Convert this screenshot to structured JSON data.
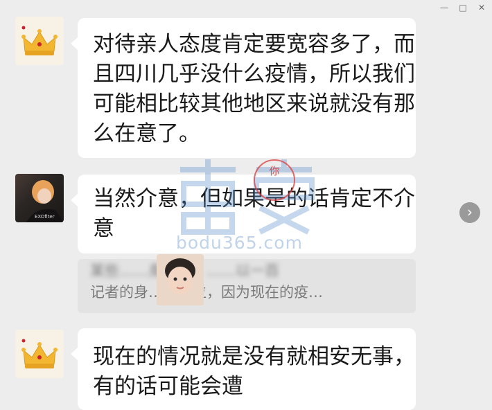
{
  "window": {
    "minimize_icon": "minimize-icon",
    "maximize_icon": "maximize-icon",
    "close_icon": "close-icon"
  },
  "messages": [
    {
      "avatar_icon": "crown-icon",
      "lines": [
        "对待亲人态度肯定要宽容多了，而",
        "且四川几乎没什么疫情，所以我们",
        "可能相比较其他地区来说就没有那",
        "么在意了。"
      ]
    },
    {
      "avatar_icon": "user-photo",
      "avatar_caption": "EXOfiter",
      "lines": [
        "当然介意，但如果是的话肯定不介",
        "意"
      ]
    },
    {
      "avatar_icon": "crown-icon",
      "lines": [
        "现在的情况就是没有就相安无事，",
        "有的话可能会遭"
      ]
    }
  ],
  "quote": {
    "lines": [
      "某些……身份好，……以一百",
      "记者的身……岗位，因为现在的疫…"
    ]
  },
  "watermark": {
    "text": "bodu365.com",
    "stamp": "你"
  },
  "colors": {
    "background": "#ededed",
    "bubble": "#ffffff",
    "crown": "#f2b630"
  }
}
